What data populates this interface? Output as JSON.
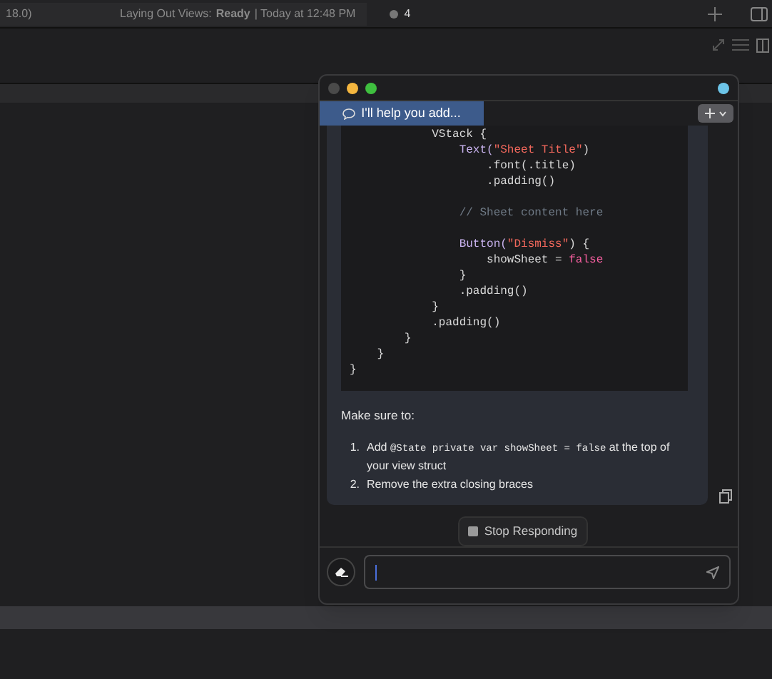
{
  "top_bar": {
    "scheme_fragment": "18.0)",
    "status_label": "Laying Out Views:",
    "status_value": "Ready",
    "status_time": "| Today at 12:48 PM",
    "issue_count": "4"
  },
  "chat": {
    "tabs": [
      {
        "label": "I'll help you add...",
        "selected": true
      }
    ],
    "code": [
      [
        {
          "kind": "plain",
          "text": "            VStack {"
        }
      ],
      [
        {
          "kind": "type",
          "text": "                Text("
        },
        {
          "kind": "string",
          "text": "\"Sheet Title\""
        },
        {
          "kind": "plain",
          "text": ")"
        }
      ],
      [
        {
          "kind": "plain",
          "text": "                    .font(.title)"
        }
      ],
      [
        {
          "kind": "plain",
          "text": "                    .padding()"
        }
      ],
      [
        {
          "kind": "blank"
        }
      ],
      [
        {
          "kind": "comment",
          "text": "                // Sheet content here"
        }
      ],
      [
        {
          "kind": "blank"
        }
      ],
      [
        {
          "kind": "type",
          "text": "                Button("
        },
        {
          "kind": "string",
          "text": "\"Dismiss\""
        },
        {
          "kind": "plain",
          "text": ") {"
        }
      ],
      [
        {
          "kind": "plain",
          "text": "                    showSheet = "
        },
        {
          "kind": "keyword",
          "text": "false"
        }
      ],
      [
        {
          "kind": "plain",
          "text": "                }"
        }
      ],
      [
        {
          "kind": "plain",
          "text": "                .padding()"
        }
      ],
      [
        {
          "kind": "plain",
          "text": "            }"
        }
      ],
      [
        {
          "kind": "plain",
          "text": "            .padding()"
        }
      ],
      [
        {
          "kind": "plain",
          "text": "        }"
        }
      ],
      [
        {
          "kind": "plain",
          "text": "    }"
        }
      ],
      [
        {
          "kind": "plain",
          "text": "}"
        }
      ]
    ],
    "intro": "Make sure to:",
    "steps": [
      {
        "number": "1.",
        "parts": [
          {
            "kind": "text",
            "text": "Add "
          },
          {
            "kind": "code",
            "text": "@State private var showSheet = false"
          },
          {
            "kind": "text",
            "text": " at the top of your view struct"
          }
        ]
      },
      {
        "number": "2.",
        "parts": [
          {
            "kind": "text",
            "text": "Remove the extra closing braces"
          }
        ]
      }
    ],
    "stop_button": "Stop Responding"
  }
}
